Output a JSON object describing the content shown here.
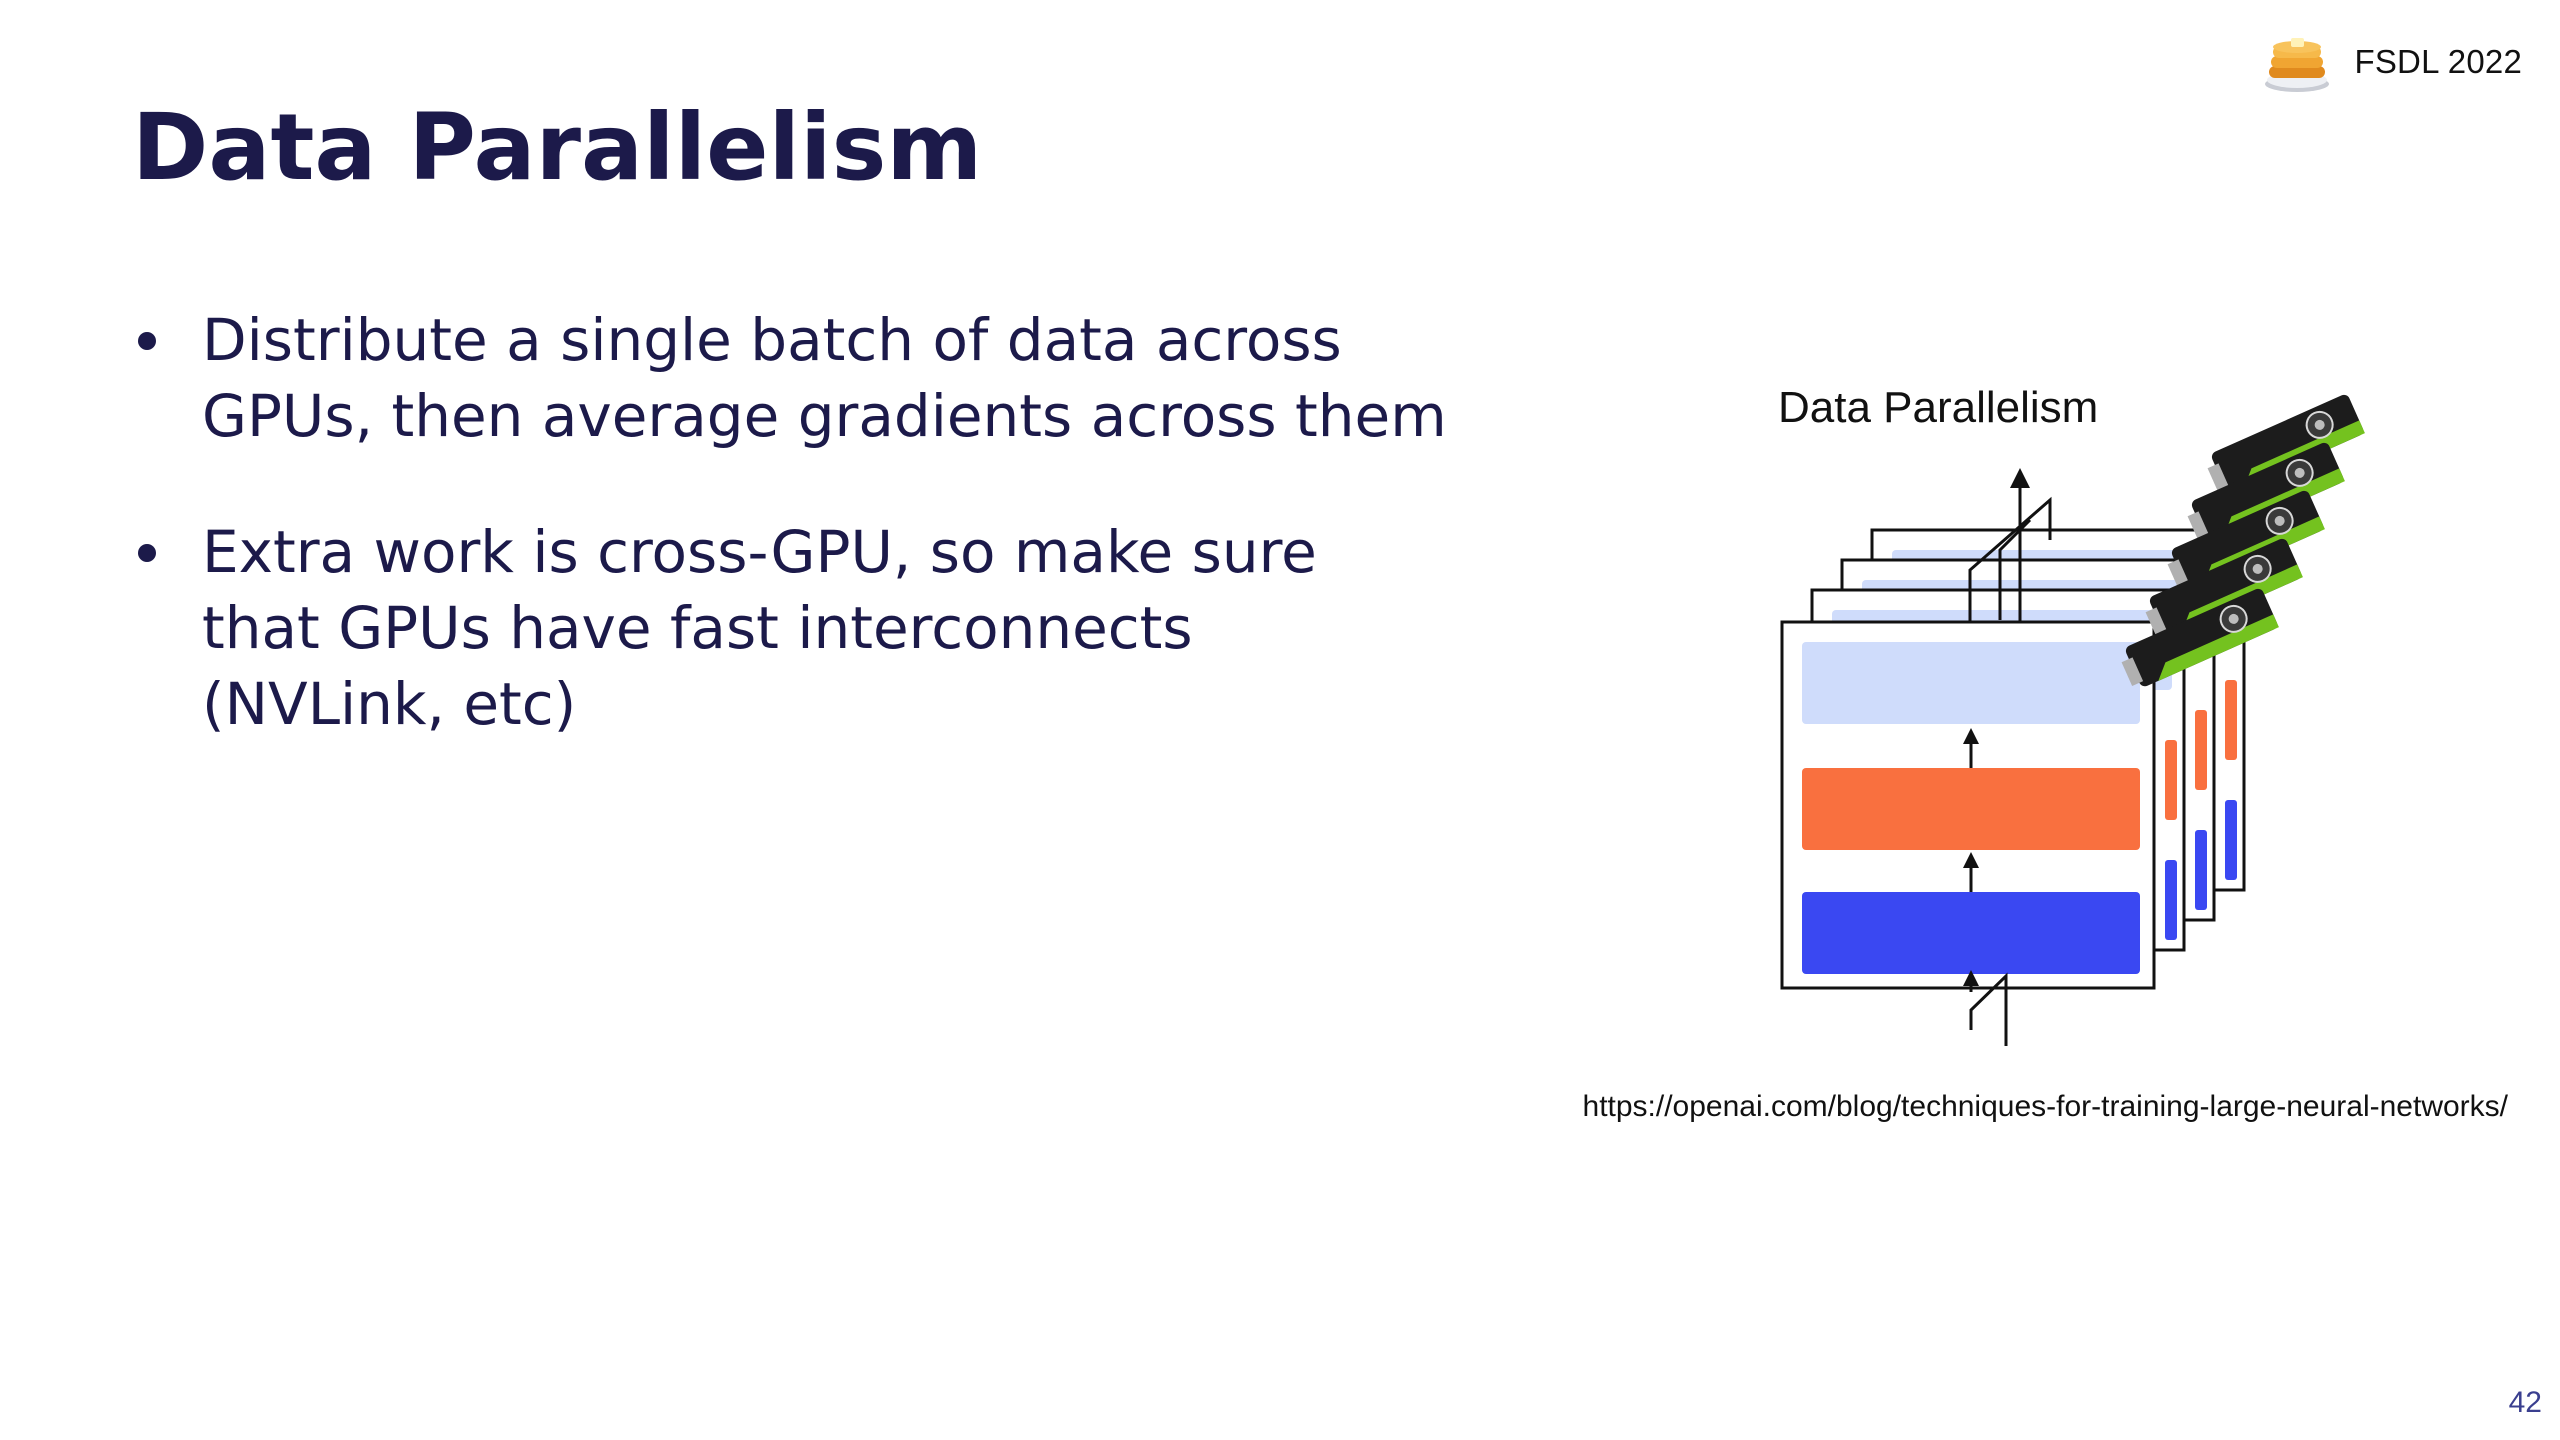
{
  "header": {
    "badge_label": "FSDL 2022",
    "badge_icon": "pancake-stack-icon"
  },
  "slide": {
    "title": "Data Parallelism",
    "bullets": [
      {
        "lines": [
          "Distribute a single batch of data across",
          "GPUs, then average gradients across them"
        ]
      },
      {
        "lines": [
          "Extra work is cross-GPU, so make sure",
          "that GPUs have fast interconnects",
          "(NVLink, etc)"
        ]
      }
    ]
  },
  "diagram": {
    "title": "Data Parallelism",
    "icon": "gpu-card-icon",
    "colors": {
      "top_layer": "#cfdcfb",
      "middle_layer": "#f9703f",
      "bottom_layer": "#3a48f2",
      "gpu_body": "#1c1c1c",
      "gpu_accent": "#74c21f"
    }
  },
  "footer": {
    "source_url": "https://openai.com/blog/techniques-for-training-large-neural-networks/",
    "page_number": "42"
  }
}
